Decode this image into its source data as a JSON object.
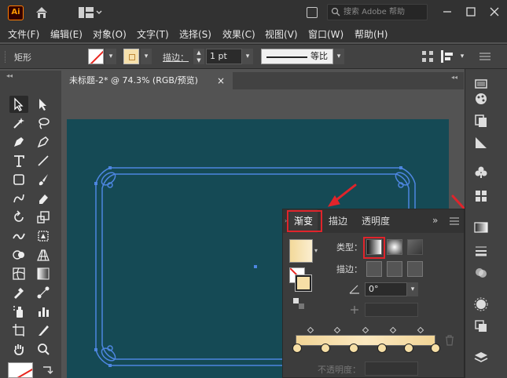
{
  "app": {
    "logo_text": "Ai",
    "search_placeholder": "搜索 Adobe 帮助"
  },
  "menu": [
    "文件(F)",
    "编辑(E)",
    "对象(O)",
    "文字(T)",
    "选择(S)",
    "效果(C)",
    "视图(V)",
    "窗口(W)",
    "帮助(H)"
  ],
  "control_bar": {
    "object_type": "矩形",
    "stroke_label": "描边：",
    "stroke_weight": "1 pt",
    "stroke_profile": "等比"
  },
  "document_tab": {
    "title": "未标题-2* @ 74.3% (RGB/预览)",
    "close": "×"
  },
  "gradient_panel": {
    "tabs": [
      "渐变",
      "描边",
      "透明度"
    ],
    "type_label": "类型：",
    "stroke_label": "描边：",
    "angle_value": "0°",
    "opacity_label": "不透明度："
  },
  "colors": {
    "artboard": "#154a55",
    "frame_stroke": "#4d86e0",
    "highlight": "#e0242b",
    "gradient_start": "#f2d596",
    "gradient_end": "#fbe8c0"
  }
}
